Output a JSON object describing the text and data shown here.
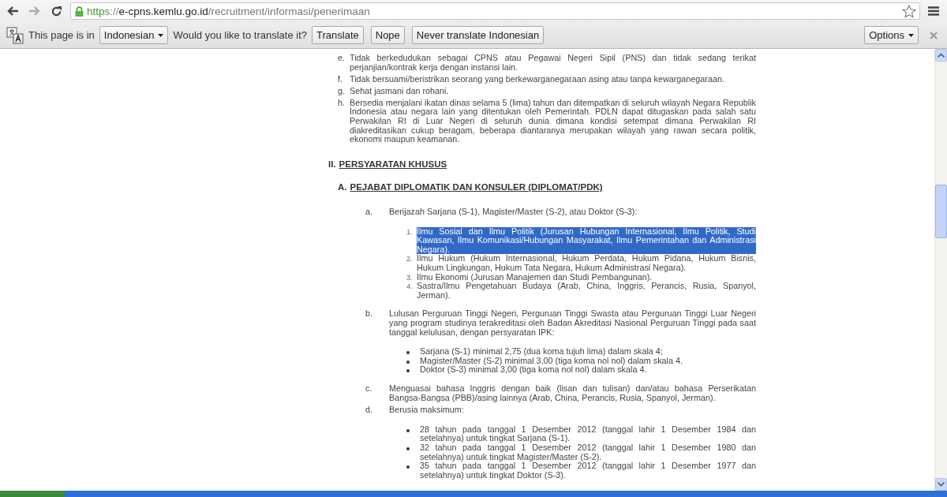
{
  "toolbar": {
    "url": [
      {
        "kind": "scheme",
        "text": "https"
      },
      {
        "kind": "separator",
        "text": "://"
      },
      {
        "kind": "host",
        "text": "e-cpns.kemlu.go.id"
      },
      {
        "kind": "path",
        "text": "/recruitment/informasi/penerimaan"
      }
    ]
  },
  "translate_bar": {
    "label": "This page is in",
    "language": "Indonesian",
    "question": "Would you like to translate it?",
    "buttons": [
      "Translate",
      "Nope",
      "Never translate Indonesian"
    ],
    "options": "Options"
  },
  "general_items": [
    {
      "marker": "e.",
      "text": "Tidak berkedudukan sebagai CPNS atau Pegawai Negeri Sipil (PNS) dan tidak sedang terikat perjanjian/kontrak kerja dengan instansi lain."
    },
    {
      "marker": "f.",
      "text": "Tidak bersuami/beristrikan seorang yang berkewarganegaraan asing atau tanpa kewarganegaraan."
    },
    {
      "marker": "g.",
      "text": "Sehat jasmani dan rohani."
    },
    {
      "marker": "h.",
      "text": "Bersedia menjalani ikatan dinas selama 5 (lima) tahun dan ditempatkan di seluruh wilayah Negara Republik Indonesia atau negara lain yang ditentukan oleh Pemerintah. PDLN dapat ditugaskan pada salah satu Perwakilan RI di Luar Negeri di seluruh dunia dimana kondisi setempat dimana Perwakilan RI diakreditasikan cukup beragam, beberapa diantaranya merupakan wilayah yang rawan secara politik, ekonomi maupun keamanan."
    }
  ],
  "section": {
    "number": "II.",
    "title": "PERSYARATAN KHUSUS"
  },
  "subsection": {
    "number": "A.",
    "title": "PEJABAT DIPLOMATIK DAN KONSULER (DIPLOMAT/PDK)"
  },
  "requirements": [
    {
      "marker": "a.",
      "text": "Berijazah Sarjana (S-1), Magister/Master (S-2), atau Doktor (S-3):",
      "list": {
        "kind": "numbered",
        "items": [
          {
            "marker": "1.",
            "text": "Ilmu Sosial dan Ilmu Politik (Jurusan Hubungan Internasional, Ilmu Politik, Studi Kawasan, Ilmu Komunikasi/Hubungan Masyarakat, Ilmu Pemerintahan dan Administrasi Negara).",
            "selected": true
          },
          {
            "marker": "2.",
            "text": "Ilmu Hukum (Hukum Internasional, Hukum Perdata, Hukum Pidana, Hukum Bisnis, Hukum Lingkungan, Hukum Tata Negara, Hukum Administrasi Negara).",
            "selected": false
          },
          {
            "marker": "3.",
            "text": "Ilmu Ekonomi (Jurusan Manajemen dan Studi Pembangunan).",
            "selected": false
          },
          {
            "marker": "4.",
            "text": "Sastra/Ilmu Pengetahuan Budaya (Arab, China, Inggris, Perancis, Rusia, Spanyol, Jerman).",
            "selected": false
          }
        ]
      }
    },
    {
      "marker": "b.",
      "text": "Lulusan Perguruan Tinggi Negeri, Perguruan Tinggi Swasta atau Perguruan Tinggi Luar Negeri yang program studinya terakreditasi oleh Badan Akreditasi Nasional Perguruan Tinggi pada saat tanggal kelulusan, dengan persyaratan IPK:",
      "list": {
        "kind": "bulleted",
        "items": [
          {
            "text": "Sarjana (S-1) minimal 2,75 (dua koma tujuh lima) dalam skala 4;"
          },
          {
            "text": "Magister/Master (S-2) minimal 3,00 (tiga koma nol nol) dalam skala 4."
          },
          {
            "text": "Doktor (S-3) minimal 3,00 (tiga koma nol nol) dalam skala 4."
          }
        ]
      }
    },
    {
      "marker": "c.",
      "text": "Menguasai bahasa Inggris dengan baik (lisan dan tulisan) dan/atau bahasa Perserikatan Bangsa-Bangsa (PBB)/asing lainnya (Arab, China, Perancis, Rusia, Spanyol, Jerman)."
    },
    {
      "marker": "d.",
      "text": "Berusia maksimum:",
      "list": {
        "kind": "bulleted",
        "items": [
          {
            "text": "28 tahun pada tanggal 1 Desember 2012 (tanggal lahir 1 Desember 1984 dan setelahnya) untuk tingkat Sarjana (S-1)."
          },
          {
            "text": "32 tahun pada tanggal 1 Desember 2012 (tanggal lahir 1 Desember 1980 dan setelahnya) untuk tingkat Magister/Master (S-2)."
          },
          {
            "text": "35 tahun pada tanggal 1 Desember 2012 (tanggal lahir 1 Desember 1977 dan setelahnya) untuk tingkat Doktor (S-3)."
          }
        ]
      }
    }
  ]
}
